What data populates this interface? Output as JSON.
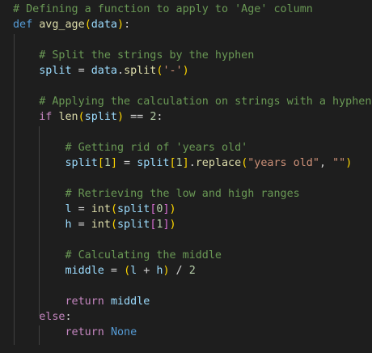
{
  "editor": {
    "lines": [
      {
        "tokens": [
          {
            "t": "# Defining a function to apply to 'Age' column",
            "c": "c-comment"
          }
        ]
      },
      {
        "tokens": [
          {
            "t": "def",
            "c": "c-kw"
          },
          {
            "t": " ",
            "c": "c-op"
          },
          {
            "t": "avg_age",
            "c": "c-fn"
          },
          {
            "t": "(",
            "c": "c-b1"
          },
          {
            "t": "data",
            "c": "c-var"
          },
          {
            "t": ")",
            "c": "c-b1"
          },
          {
            "t": ":",
            "c": "c-op"
          }
        ]
      },
      {
        "tokens": []
      },
      {
        "tokens": [
          {
            "t": "    # Split the strings by the hyphen",
            "c": "c-comment"
          }
        ]
      },
      {
        "tokens": [
          {
            "t": "    ",
            "c": "c-op"
          },
          {
            "t": "split",
            "c": "c-var"
          },
          {
            "t": " = ",
            "c": "c-op"
          },
          {
            "t": "data",
            "c": "c-var"
          },
          {
            "t": ".",
            "c": "c-op"
          },
          {
            "t": "split",
            "c": "c-fn"
          },
          {
            "t": "(",
            "c": "c-b1"
          },
          {
            "t": "'-'",
            "c": "c-str"
          },
          {
            "t": ")",
            "c": "c-b1"
          }
        ]
      },
      {
        "tokens": []
      },
      {
        "tokens": [
          {
            "t": "    # Applying the calculation on strings with a hyphen",
            "c": "c-comment"
          }
        ]
      },
      {
        "tokens": [
          {
            "t": "    ",
            "c": "c-op"
          },
          {
            "t": "if",
            "c": "c-ctrl"
          },
          {
            "t": " ",
            "c": "c-op"
          },
          {
            "t": "len",
            "c": "c-fn"
          },
          {
            "t": "(",
            "c": "c-b1"
          },
          {
            "t": "split",
            "c": "c-var"
          },
          {
            "t": ")",
            "c": "c-b1"
          },
          {
            "t": " == ",
            "c": "c-op"
          },
          {
            "t": "2",
            "c": "c-num"
          },
          {
            "t": ":",
            "c": "c-op"
          }
        ]
      },
      {
        "tokens": []
      },
      {
        "tokens": [
          {
            "t": "        # Getting rid of 'years old'",
            "c": "c-comment"
          }
        ]
      },
      {
        "tokens": [
          {
            "t": "        ",
            "c": "c-op"
          },
          {
            "t": "split",
            "c": "c-var"
          },
          {
            "t": "[",
            "c": "c-b1"
          },
          {
            "t": "1",
            "c": "c-num"
          },
          {
            "t": "]",
            "c": "c-b1"
          },
          {
            "t": " = ",
            "c": "c-op"
          },
          {
            "t": "split",
            "c": "c-var"
          },
          {
            "t": "[",
            "c": "c-b1"
          },
          {
            "t": "1",
            "c": "c-num"
          },
          {
            "t": "]",
            "c": "c-b1"
          },
          {
            "t": ".",
            "c": "c-op"
          },
          {
            "t": "replace",
            "c": "c-fn"
          },
          {
            "t": "(",
            "c": "c-b1"
          },
          {
            "t": "\"years old\"",
            "c": "c-str"
          },
          {
            "t": ", ",
            "c": "c-op"
          },
          {
            "t": "\"\"",
            "c": "c-str"
          },
          {
            "t": ")",
            "c": "c-b1"
          }
        ]
      },
      {
        "tokens": []
      },
      {
        "tokens": [
          {
            "t": "        # Retrieving the low and high ranges",
            "c": "c-comment"
          }
        ]
      },
      {
        "tokens": [
          {
            "t": "        ",
            "c": "c-op"
          },
          {
            "t": "l",
            "c": "c-var"
          },
          {
            "t": " = ",
            "c": "c-op"
          },
          {
            "t": "int",
            "c": "c-fn"
          },
          {
            "t": "(",
            "c": "c-b1"
          },
          {
            "t": "split",
            "c": "c-var"
          },
          {
            "t": "[",
            "c": "c-b2"
          },
          {
            "t": "0",
            "c": "c-num"
          },
          {
            "t": "]",
            "c": "c-b2"
          },
          {
            "t": ")",
            "c": "c-b1"
          }
        ]
      },
      {
        "tokens": [
          {
            "t": "        ",
            "c": "c-op"
          },
          {
            "t": "h",
            "c": "c-var"
          },
          {
            "t": " = ",
            "c": "c-op"
          },
          {
            "t": "int",
            "c": "c-fn"
          },
          {
            "t": "(",
            "c": "c-b1"
          },
          {
            "t": "split",
            "c": "c-var"
          },
          {
            "t": "[",
            "c": "c-b2"
          },
          {
            "t": "1",
            "c": "c-num"
          },
          {
            "t": "]",
            "c": "c-b2"
          },
          {
            "t": ")",
            "c": "c-b1"
          }
        ]
      },
      {
        "tokens": []
      },
      {
        "tokens": [
          {
            "t": "        # Calculating the middle",
            "c": "c-comment"
          }
        ]
      },
      {
        "tokens": [
          {
            "t": "        ",
            "c": "c-op"
          },
          {
            "t": "middle",
            "c": "c-var"
          },
          {
            "t": " = ",
            "c": "c-op"
          },
          {
            "t": "(",
            "c": "c-b1"
          },
          {
            "t": "l",
            "c": "c-var"
          },
          {
            "t": " + ",
            "c": "c-op"
          },
          {
            "t": "h",
            "c": "c-var"
          },
          {
            "t": ")",
            "c": "c-b1"
          },
          {
            "t": " / ",
            "c": "c-op"
          },
          {
            "t": "2",
            "c": "c-num"
          }
        ]
      },
      {
        "tokens": []
      },
      {
        "tokens": [
          {
            "t": "        ",
            "c": "c-op"
          },
          {
            "t": "return",
            "c": "c-ctrl"
          },
          {
            "t": " ",
            "c": "c-op"
          },
          {
            "t": "middle",
            "c": "c-var"
          }
        ]
      },
      {
        "tokens": [
          {
            "t": "    ",
            "c": "c-op"
          },
          {
            "t": "else",
            "c": "c-ctrl"
          },
          {
            "t": ":",
            "c": "c-op"
          }
        ]
      },
      {
        "tokens": [
          {
            "t": "        ",
            "c": "c-op"
          },
          {
            "t": "return",
            "c": "c-ctrl"
          },
          {
            "t": " ",
            "c": "c-op"
          },
          {
            "t": "None",
            "c": "c-kw"
          }
        ]
      }
    ]
  }
}
